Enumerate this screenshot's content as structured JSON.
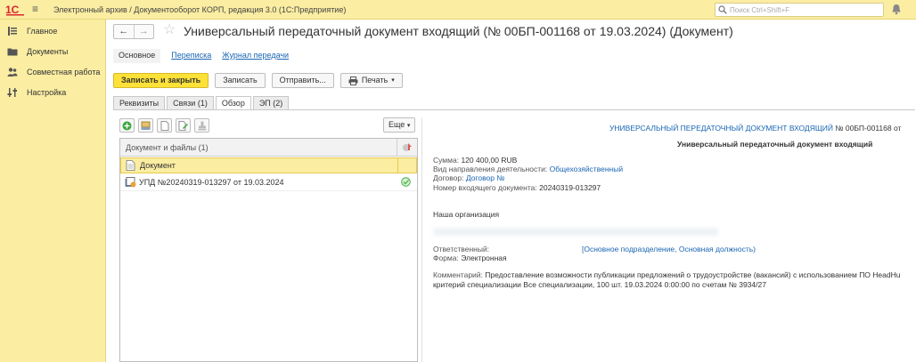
{
  "app": {
    "title": "Электронный архив / Документооборот КОРП, редакция 3.0  (1С:Предприятие)",
    "search_placeholder": "Поиск Ctrl+Shift+F"
  },
  "sidebar": {
    "items": [
      {
        "label": "Главное",
        "icon": "menu-lines-icon"
      },
      {
        "label": "Документы",
        "icon": "folder-icon"
      },
      {
        "label": "Совместная работа",
        "icon": "people-icon"
      },
      {
        "label": "Настройка",
        "icon": "settings-sliders-icon"
      }
    ]
  },
  "document": {
    "title": "Универсальный передаточный документ входящий (№ 00БП-001168 от 19.03.2024) (Документ)"
  },
  "navtabs": {
    "main": "Основное",
    "correspondence": "Переписка",
    "log": "Журнал передачи"
  },
  "toolbar": {
    "save_close": "Записать и закрыть",
    "save": "Записать",
    "send": "Отправить...",
    "print": "Печать"
  },
  "tabs": {
    "requisites": "Реквизиты",
    "links": "Связи (1)",
    "overview": "Обзор",
    "ep": "ЭП (2)"
  },
  "files": {
    "more": "Еще",
    "header": "Документ и файлы (1)",
    "rows": [
      {
        "label": "Документ"
      },
      {
        "label": "УПД №20240319-013297 от 19.03.2024"
      }
    ]
  },
  "preview": {
    "header_link": "УНИВЕРСАЛЬНЫЙ ПЕРЕДАТОЧНЫЙ ДОКУМЕНТ ВХОДЯЩИЙ",
    "header_num": "№ 00БП-001168 от",
    "subtitle": "Универсальный передаточный документ входящий",
    "sum_label": "Сумма:",
    "sum_value": "120 400,00 RUB",
    "direction_label": "Вид направления деятельности:",
    "direction_value": "Общехозяйственный",
    "contract_label": "Договор:",
    "contract_value": "Договор №",
    "incoming_label": "Номер входящего документа:",
    "incoming_value": "20240319-013297",
    "org_label": "Наша организация",
    "responsible_label": "Ответственный:",
    "responsible_value": "[Основное подразделение, Основная должность)",
    "form_label": "Форма:",
    "form_value": "Электронная",
    "comment_label": "Комментарий:",
    "comment_line1": "Предоставление возможности публикации предложений о трудоустройстве (вакансий) с использованием ПО HeadHu",
    "comment_line2": "критерий специализации Все специализации, 100 шт. 19.03.2024 0:00:00 по счетам № 3934/27"
  }
}
